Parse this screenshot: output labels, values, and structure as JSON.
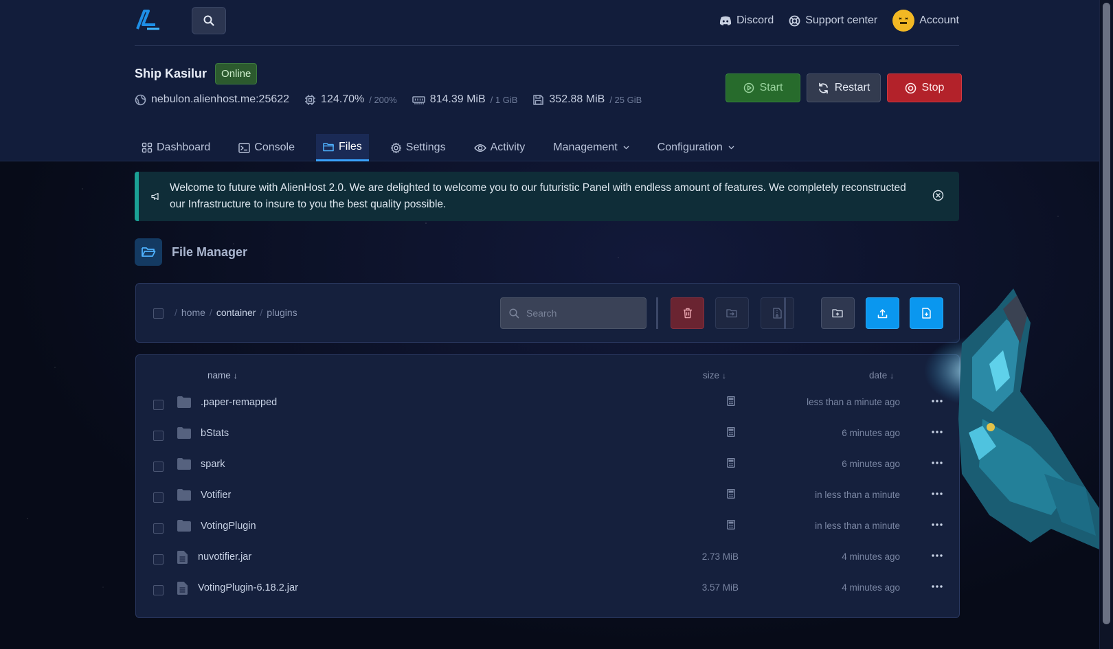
{
  "nav": {
    "discord": "Discord",
    "support": "Support center",
    "account": "Account"
  },
  "server": {
    "name": "Ship Kasilur",
    "status": "Online",
    "address": "nebulon.alienhost.me:25622",
    "cpu": "124.70%",
    "cpu_limit": "/ 200%",
    "memory": "814.39 MiB",
    "memory_limit": "/ 1 GiB",
    "disk": "352.88 MiB",
    "disk_limit": "/ 25 GiB"
  },
  "power": {
    "start": "Start",
    "restart": "Restart",
    "stop": "Stop"
  },
  "tabs": [
    {
      "label": "Dashboard",
      "icon": "grid-icon"
    },
    {
      "label": "Console",
      "icon": "terminal-icon"
    },
    {
      "label": "Files",
      "icon": "folder-icon",
      "active": true
    },
    {
      "label": "Settings",
      "icon": "gear-icon"
    },
    {
      "label": "Activity",
      "icon": "eye-icon"
    },
    {
      "label": "Management",
      "icon": "chevron-down-icon"
    },
    {
      "label": "Configuration",
      "icon": "chevron-down-icon"
    }
  ],
  "alert": {
    "text": "Welcome to future with AlienHost 2.0. We are delighted to welcome you to our futuristic Panel with endless amount of features. We completely reconstructed our Infrastructure to insure to you the best quality possible."
  },
  "file_manager": {
    "title": "File Manager",
    "breadcrumb": [
      "home",
      "container",
      "plugins"
    ],
    "search_placeholder": "Search",
    "columns": {
      "name": "name",
      "size": "size",
      "date": "date"
    },
    "files": [
      {
        "name": ".paper-remapped",
        "type": "folder",
        "size": "",
        "date": "less than a minute ago"
      },
      {
        "name": "bStats",
        "type": "folder",
        "size": "",
        "date": "6 minutes ago"
      },
      {
        "name": "spark",
        "type": "folder",
        "size": "",
        "date": "6 minutes ago"
      },
      {
        "name": "Votifier",
        "type": "folder",
        "size": "",
        "date": "in less than a minute"
      },
      {
        "name": "VotingPlugin",
        "type": "folder",
        "size": "",
        "date": "in less than a minute"
      },
      {
        "name": "nuvotifier.jar",
        "type": "file",
        "size": "2.73 MiB",
        "date": "4 minutes ago"
      },
      {
        "name": "VotingPlugin-6.18.2.jar",
        "type": "file",
        "size": "3.57 MiB",
        "date": "4 minutes ago"
      }
    ]
  },
  "colors": {
    "accent": "#0a97ef",
    "online": "#2c5a2e",
    "stop": "#b3222a",
    "start": "#276b2c"
  }
}
